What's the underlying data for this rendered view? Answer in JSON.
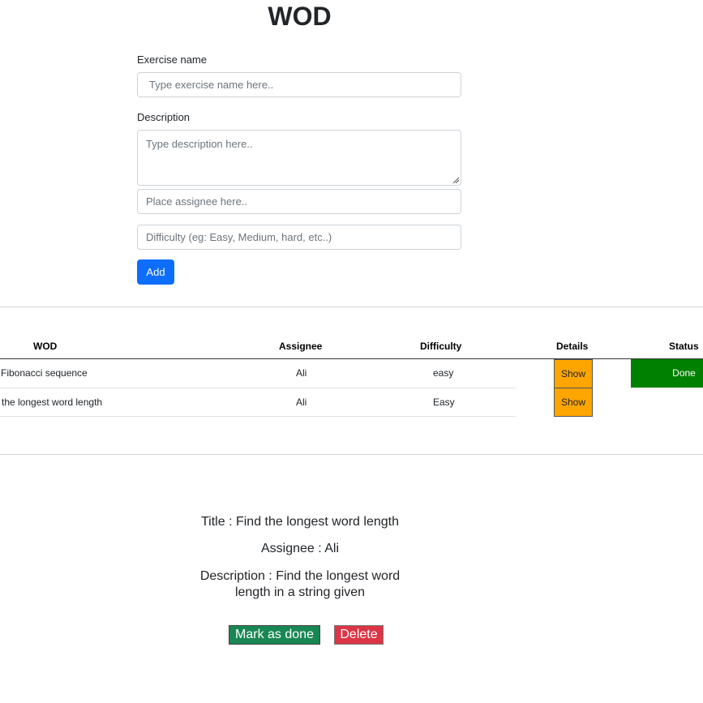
{
  "page": {
    "title": "WOD"
  },
  "form": {
    "exercise_label": "Exercise name",
    "exercise_placeholder": "Type exercise name here..",
    "description_label": "Description",
    "description_placeholder": "Type description here..",
    "assignee_placeholder": "Place assignee here..",
    "difficulty_placeholder": "Difficulty (eg: Easy, Medium, hard, etc..)",
    "add_label": "Add"
  },
  "table": {
    "headers": [
      "WOD",
      "Assignee",
      "Difficulty",
      "Details",
      "Status"
    ],
    "rows": [
      {
        "wod": "Fibonacci sequence",
        "assignee": "Ali",
        "difficulty": "easy",
        "details": "Show",
        "status": "Done"
      },
      {
        "wod": "the longest word length",
        "assignee": "Ali",
        "difficulty": "Easy",
        "details": "Show",
        "status": ""
      }
    ]
  },
  "detail": {
    "title": "Title : Find the longest word length",
    "assignee": "Assignee : Ali",
    "description": "Description : Find the longest word length in a string given",
    "mark_done_label": "Mark as done",
    "delete_label": "Delete"
  },
  "colors": {
    "primary": "#0d6efd",
    "show_button": "#ffa500",
    "done": "#008000",
    "mark_done": "#198754",
    "delete": "#dc3545"
  }
}
